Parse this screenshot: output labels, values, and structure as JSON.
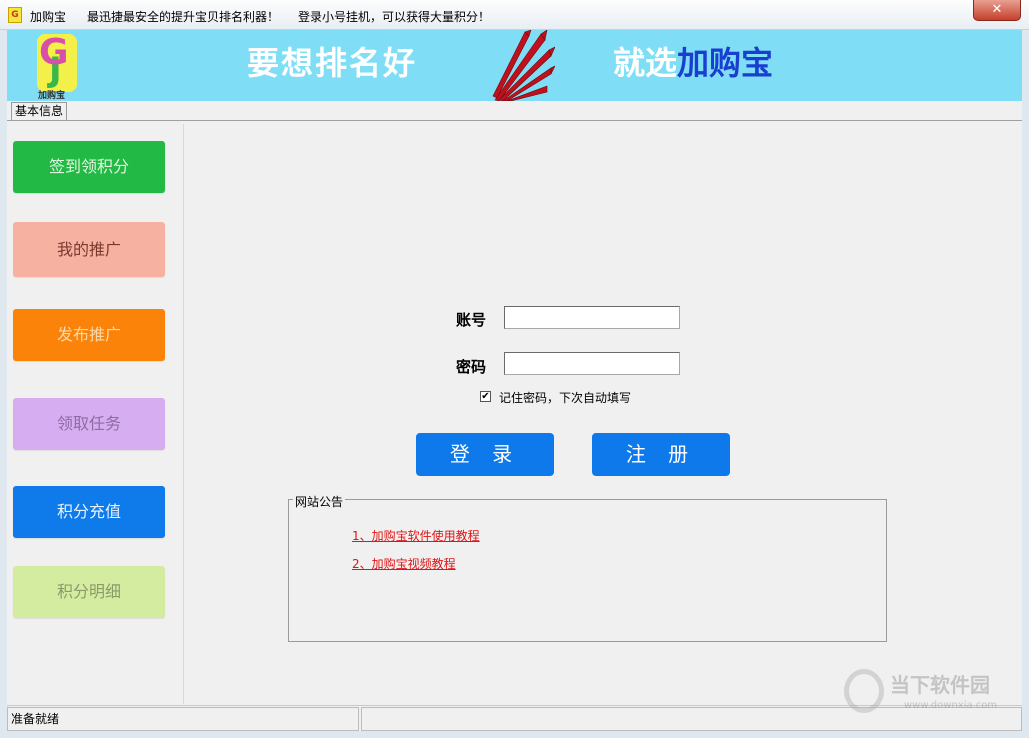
{
  "titlebar": {
    "app_title": "加购宝",
    "message1": "最迅捷最安全的提升宝贝排名利器！",
    "message2": "登录小号挂机，可以获得大量积分！",
    "close_glyph": "✕",
    "icon_letter": "G"
  },
  "banner": {
    "logo_letter_g": "G",
    "logo_letter_j": "J",
    "logo_text": "加购宝",
    "slogan_left": "要想排名好",
    "slogan_right_prefix": "就选",
    "slogan_right_brand": "加购宝",
    "brand_color": "#1a3fd0",
    "background_color": "#7fdef5"
  },
  "tabs": [
    {
      "label": "基本信息"
    }
  ],
  "sidebar": {
    "items": [
      {
        "label": "签到领积分",
        "color": "#22b944"
      },
      {
        "label": "我的推广",
        "color": "#f6b1a1"
      },
      {
        "label": "发布推广",
        "color": "#fb830a"
      },
      {
        "label": "领取任务",
        "color": "#d7adf1"
      },
      {
        "label": "积分充值",
        "color": "#0f7bea"
      },
      {
        "label": "积分明细",
        "color": "#d3ec9f"
      }
    ]
  },
  "login": {
    "account_label": "账号",
    "account_value": "",
    "password_label": "密码",
    "password_value": "",
    "remember_checked": true,
    "remember_label": "记住密码，下次自动填写",
    "login_button": "登 录",
    "register_button": "注 册",
    "button_color": "#0e79ea"
  },
  "notice": {
    "title": "网站公告",
    "links": [
      "1、加购宝软件使用教程",
      "2、加购宝视频教程"
    ],
    "link_color": "#e01414"
  },
  "statusbar": {
    "status_text": "准备就绪"
  },
  "watermark": {
    "text": "当下软件园",
    "url": "www.downxia.com"
  }
}
